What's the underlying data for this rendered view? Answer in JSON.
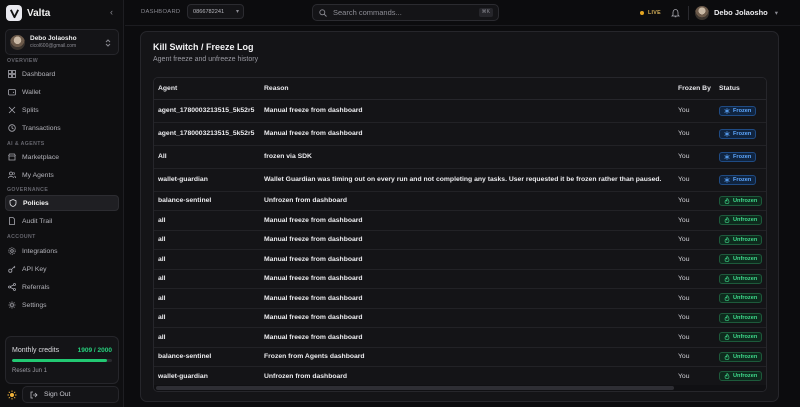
{
  "brand": {
    "name": "Valta",
    "collapse_icon": "chevron-left-icon"
  },
  "user": {
    "name": "Debo Jolaosho",
    "email": "cicol600@gmail.com"
  },
  "sidebar": {
    "sections": {
      "overview": "OVERVIEW",
      "ai_agents": "AI & AGENTS",
      "governance": "GOVERNANCE",
      "account": "ACCOUNT"
    },
    "items": [
      {
        "label": "Dashboard",
        "icon": "grid-icon",
        "active": false
      },
      {
        "label": "Wallet",
        "icon": "wallet-icon",
        "active": false
      },
      {
        "label": "Splits",
        "icon": "split-icon",
        "active": false
      },
      {
        "label": "Transactions",
        "icon": "clock-icon",
        "active": false
      },
      {
        "label": "Marketplace",
        "icon": "store-icon",
        "active": false
      },
      {
        "label": "My Agents",
        "icon": "users-icon",
        "active": false
      },
      {
        "label": "Policies",
        "icon": "shield-icon",
        "active": true
      },
      {
        "label": "Audit Trail",
        "icon": "file-icon",
        "active": false
      },
      {
        "label": "Integrations",
        "icon": "gear-icon",
        "active": false
      },
      {
        "label": "API Key",
        "icon": "key-icon",
        "active": false
      },
      {
        "label": "Referrals",
        "icon": "referral-icon",
        "active": false
      },
      {
        "label": "Settings",
        "icon": "settings-icon",
        "active": false
      }
    ]
  },
  "credits": {
    "label": "Monthly credits",
    "count": "1909 / 2000",
    "used": 1909,
    "total": 2000,
    "reset": "Resets Jun 1"
  },
  "footer": {
    "signout": "Sign Out"
  },
  "topbar": {
    "breadcrumb": "DASHBOARD",
    "account_id": "0866782241",
    "search_placeholder": "Search commands...",
    "shortcut": "⌘K",
    "live": "LIVE",
    "user_name": "Debo Jolaosho"
  },
  "page": {
    "title": "Kill Switch / Freeze Log",
    "subtitle": "Agent freeze and unfreeze history"
  },
  "table": {
    "headers": [
      "Agent",
      "Reason",
      "Frozen By",
      "Status"
    ],
    "rows": [
      {
        "agent": "agent_1780003213515_5k52r5",
        "reason": "Manual freeze from dashboard",
        "by": "You",
        "status": "Frozen"
      },
      {
        "agent": "agent_1780003213515_5k52r5",
        "reason": "Manual freeze from dashboard",
        "by": "You",
        "status": "Frozen"
      },
      {
        "agent": "All",
        "reason": "frozen via SDK",
        "by": "You",
        "status": "Frozen"
      },
      {
        "agent": "wallet-guardian",
        "reason": "Wallet Guardian was timing out on every run and not completing any tasks. User requested it be frozen rather than paused.",
        "by": "You",
        "status": "Frozen"
      },
      {
        "agent": "balance-sentinel",
        "reason": "Unfrozen from dashboard",
        "by": "You",
        "status": "Unfrozen"
      },
      {
        "agent": "all",
        "reason": "Manual freeze from dashboard",
        "by": "You",
        "status": "Unfrozen"
      },
      {
        "agent": "all",
        "reason": "Manual freeze from dashboard",
        "by": "You",
        "status": "Unfrozen"
      },
      {
        "agent": "all",
        "reason": "Manual freeze from dashboard",
        "by": "You",
        "status": "Unfrozen"
      },
      {
        "agent": "all",
        "reason": "Manual freeze from dashboard",
        "by": "You",
        "status": "Unfrozen"
      },
      {
        "agent": "all",
        "reason": "Manual freeze from dashboard",
        "by": "You",
        "status": "Unfrozen"
      },
      {
        "agent": "all",
        "reason": "Manual freeze from dashboard",
        "by": "You",
        "status": "Unfrozen"
      },
      {
        "agent": "all",
        "reason": "Manual freeze from dashboard",
        "by": "You",
        "status": "Unfrozen"
      },
      {
        "agent": "balance-sentinel",
        "reason": "Frozen from Agents dashboard",
        "by": "You",
        "status": "Unfrozen"
      },
      {
        "agent": "wallet-guardian",
        "reason": "Unfrozen from dashboard",
        "by": "You",
        "status": "Unfrozen"
      }
    ]
  },
  "colors": {
    "accent_green": "#22c872",
    "frozen_blue": "#5ea8ff",
    "live_amber": "#e5a520",
    "background": "#0c0c0e"
  }
}
